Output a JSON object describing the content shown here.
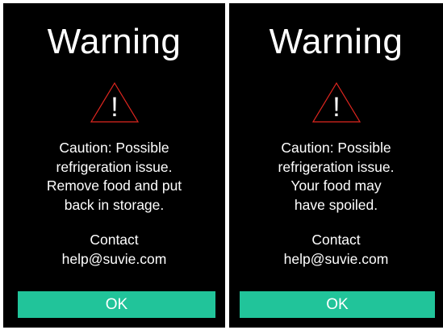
{
  "colors": {
    "background": "#000000",
    "text": "#ffffff",
    "button": "#21c49a",
    "icon_outline": "#e0261f"
  },
  "screens": [
    {
      "title": "Warning",
      "icon": "warning-triangle-icon",
      "icon_glyph": "!",
      "message_lines": [
        "Caution: Possible",
        "refrigeration issue.",
        "Remove food and put",
        "back in storage."
      ],
      "contact_label": "Contact",
      "contact_email": "help@suvie.com",
      "ok_label": "OK"
    },
    {
      "title": "Warning",
      "icon": "warning-triangle-icon",
      "icon_glyph": "!",
      "message_lines": [
        "Caution: Possible",
        "refrigeration issue.",
        "Your food may",
        "have spoiled."
      ],
      "contact_label": "Contact",
      "contact_email": "help@suvie.com",
      "ok_label": "OK"
    }
  ]
}
